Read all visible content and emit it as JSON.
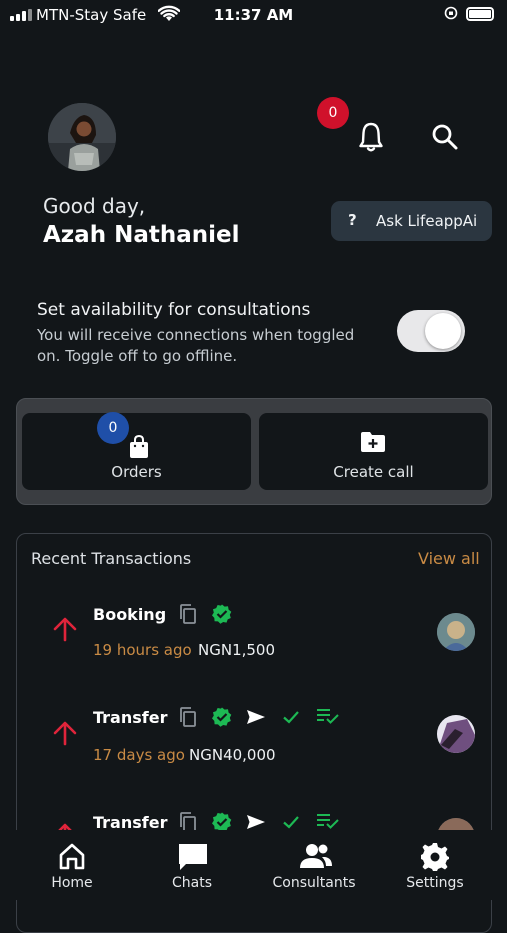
{
  "status_bar": {
    "carrier": "MTN-Stay Safe",
    "time": "11:37 AM"
  },
  "header": {
    "notification_count": "0",
    "greeting": "Good day,",
    "user_name": "Azah Nathaniel",
    "ask_button_label": "Ask LifeappAi",
    "ask_button_icon": "?"
  },
  "availability": {
    "title": "Set availability for consultations",
    "description": "You will receive connections when toggled on. Toggle off to go offline.",
    "enabled": true
  },
  "actions": {
    "orders_label": "Orders",
    "orders_count": "0",
    "create_call_label": "Create call"
  },
  "transactions": {
    "title": "Recent Transactions",
    "view_all_label": "View all",
    "items": [
      {
        "type": "Booking",
        "time_ago": "19 hours ago",
        "amount": "NGN1,500"
      },
      {
        "type": "Transfer",
        "time_ago": "17 days ago",
        "amount": "NGN40,000"
      },
      {
        "type": "Transfer",
        "time_ago": "",
        "amount": ""
      }
    ]
  },
  "bottom_nav": {
    "items": [
      {
        "label": "Home",
        "icon": "home-icon"
      },
      {
        "label": "Chats",
        "icon": "chat-icon"
      },
      {
        "label": "Consultants",
        "icon": "people-icon"
      },
      {
        "label": "Settings",
        "icon": "gear-icon"
      }
    ]
  },
  "colors": {
    "background": "#121619",
    "accent_orange": "#c98b45",
    "badge_red": "#d0112b",
    "badge_blue": "#1f4fa8",
    "arrow_red": "#e0243b",
    "verified_green": "#1db954"
  }
}
